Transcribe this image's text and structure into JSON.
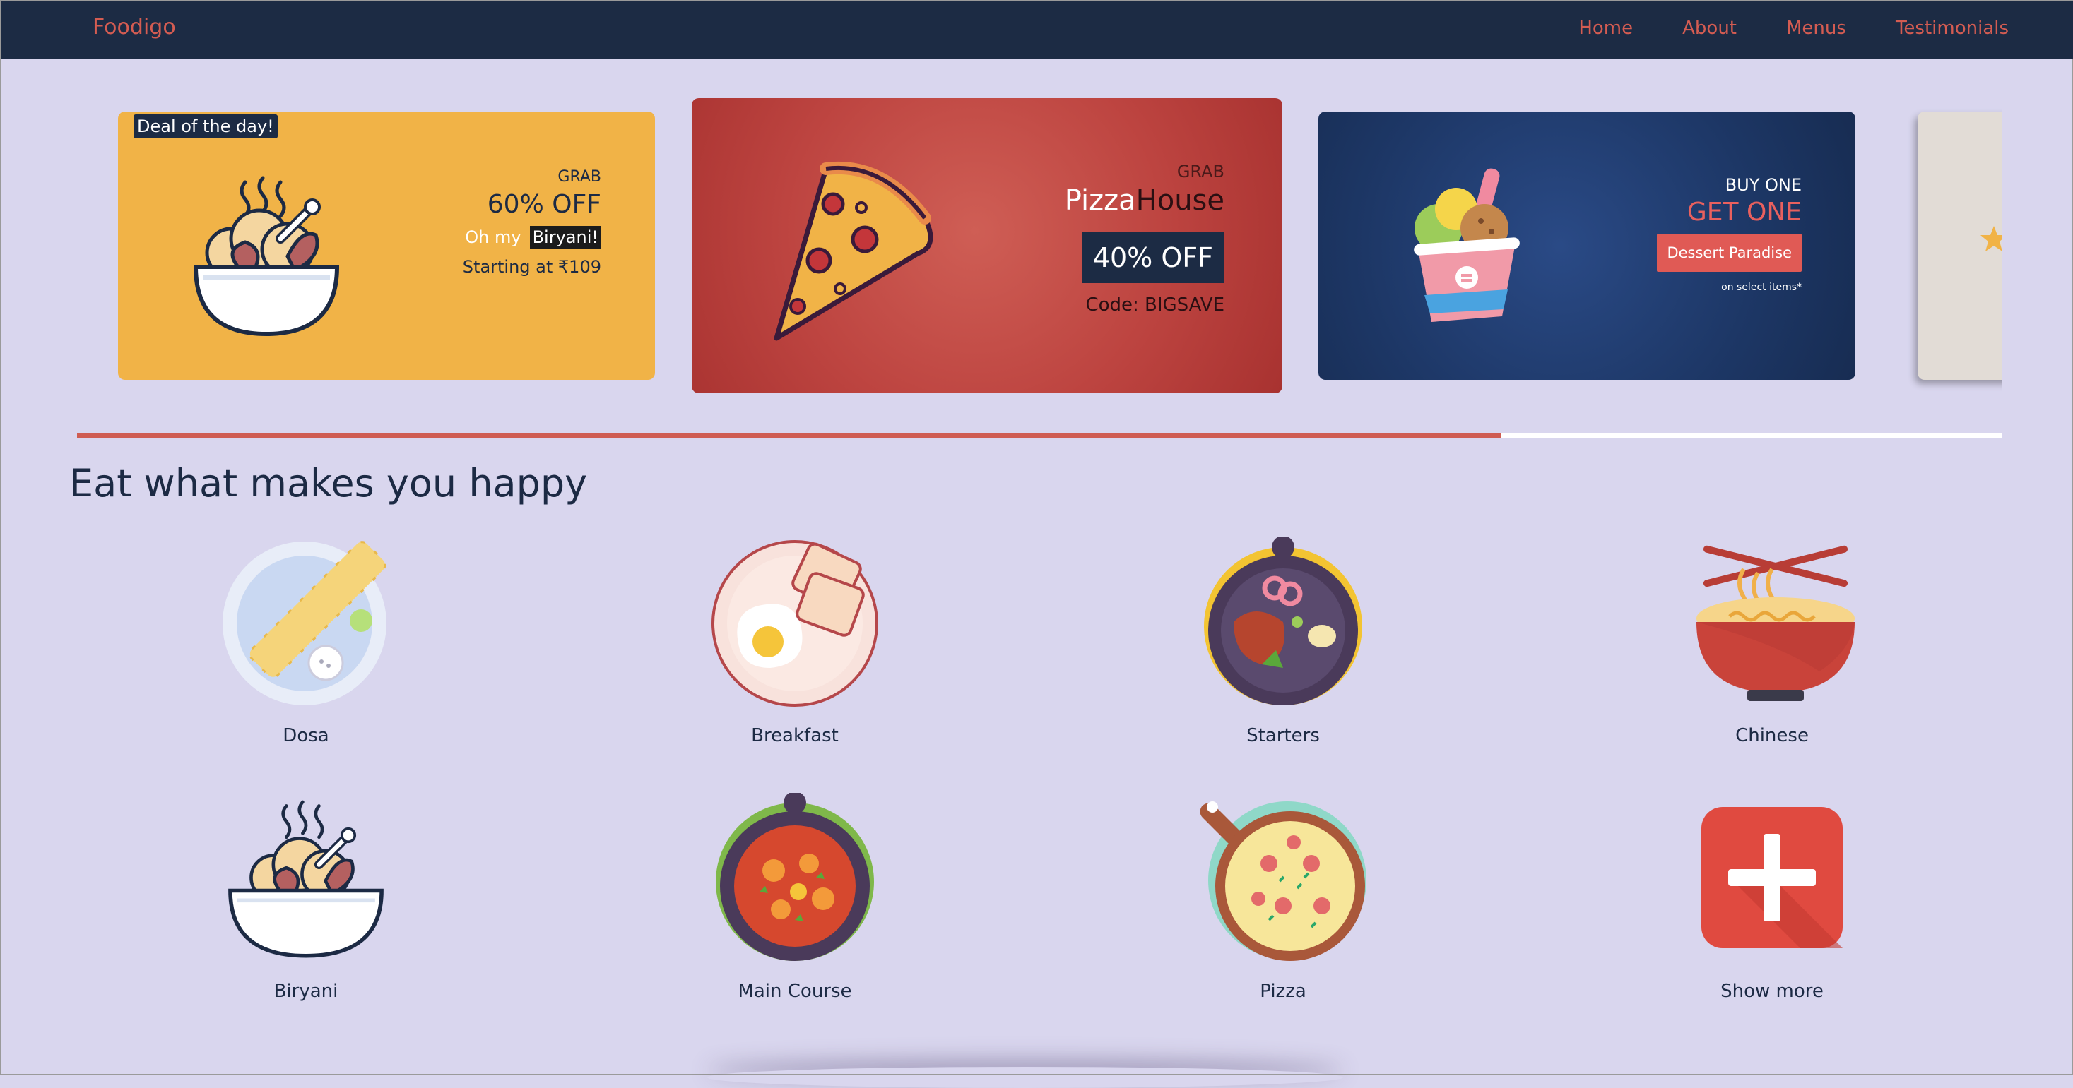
{
  "nav": {
    "brand": "Foodigo",
    "links": [
      "Home",
      "About",
      "Menus",
      "Testimonials"
    ]
  },
  "carousel": {
    "card1": {
      "badge": "Deal of the day!",
      "grab": "GRAB",
      "discount": "60% OFF",
      "oh_my": "Oh my",
      "item": "Biryani!",
      "starting": "Starting at ₹109",
      "bg_color": "#f1b347"
    },
    "card2": {
      "grab": "GRAB",
      "brand_part1": "Pizza",
      "brand_part2": "House",
      "discount": "40% OFF",
      "code": "Code: BIGSAVE",
      "bg_color": "#bd4440"
    },
    "card3": {
      "buy_one": "BUY ONE",
      "get_one": "GET ONE",
      "button": "Dessert Paradise",
      "note": "on select items*",
      "bg_color": "#1d3766"
    },
    "progress_fraction": 0.74
  },
  "section": {
    "title": "Eat what makes you happy",
    "categories": [
      {
        "label": "Dosa",
        "icon": "dosa-icon"
      },
      {
        "label": "Breakfast",
        "icon": "breakfast-icon"
      },
      {
        "label": "Starters",
        "icon": "starters-icon"
      },
      {
        "label": "Chinese",
        "icon": "chinese-noodles-icon"
      },
      {
        "label": "Biryani",
        "icon": "biryani-icon"
      },
      {
        "label": "Main Course",
        "icon": "main-course-icon"
      },
      {
        "label": "Pizza",
        "icon": "pizza-icon"
      },
      {
        "label": "Show more",
        "icon": "plus-icon"
      }
    ]
  },
  "colors": {
    "navbar": "#1c2b44",
    "accent": "#d45c52",
    "page_bg": "#d9d6ee"
  }
}
